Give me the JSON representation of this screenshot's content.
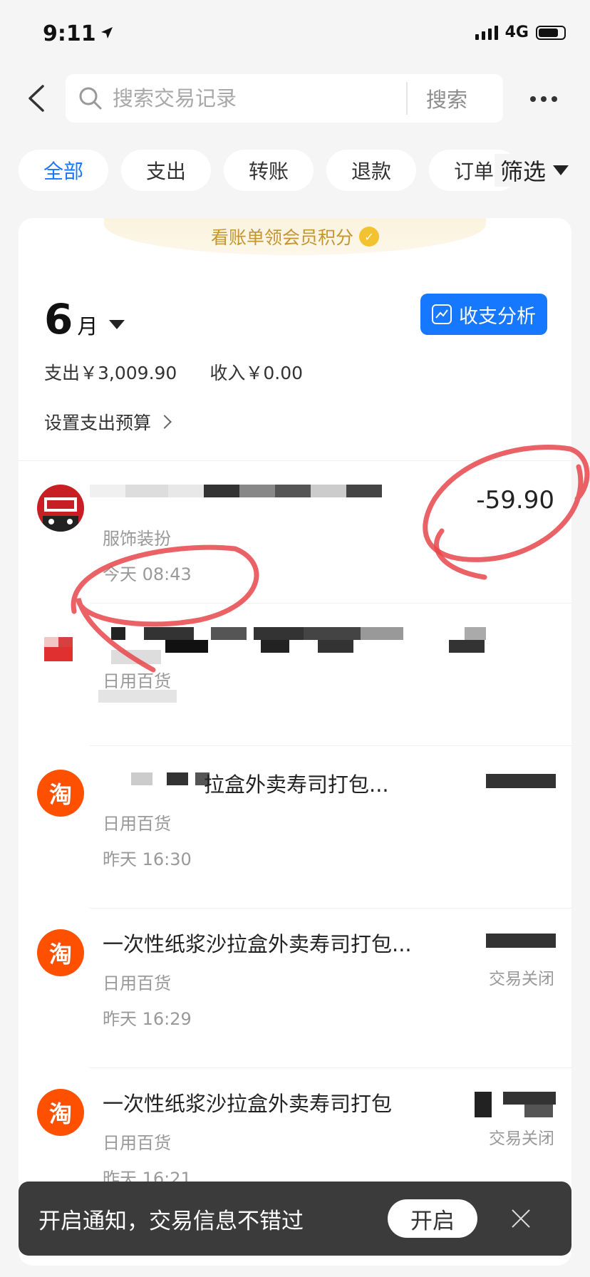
{
  "status_bar": {
    "time": "9:11",
    "network": "4G"
  },
  "search": {
    "placeholder": "搜索交易记录",
    "button_label": "搜索"
  },
  "tabs": [
    "全部",
    "支出",
    "转账",
    "退款",
    "订单"
  ],
  "filter_label": "筛选",
  "promo": {
    "text": "看账单领会员积分"
  },
  "month": {
    "number": "6",
    "unit": "月"
  },
  "analysis_button": "收支分析",
  "summary": {
    "expense": "支出￥3,009.90",
    "income": "收入￥0.00"
  },
  "budget_link": "设置支出预算",
  "transactions": [
    {
      "title": "",
      "category": "服饰装扮",
      "time": "今天 08:43",
      "amount": "-59.90",
      "status": ""
    },
    {
      "title": "",
      "category": "日用百货",
      "time": "",
      "amount": "",
      "status": ""
    },
    {
      "title": "拉盒外卖寿司打包...",
      "category": "日用百货",
      "time": "昨天 16:30",
      "amount": "",
      "status": ""
    },
    {
      "title": "一次性纸浆沙拉盒外卖寿司打包...",
      "category": "日用百货",
      "time": "昨天 16:29",
      "amount": "",
      "status": "交易关闭"
    },
    {
      "title": "一次性纸浆沙拉盒外卖寿司打包",
      "category": "日用百货",
      "time": "昨天 16:21",
      "amount": "",
      "status": "交易关闭"
    }
  ],
  "taobao_icon_text": "淘",
  "toast": {
    "text": "开启通知，交易信息不错过",
    "button": "开启"
  },
  "colors": {
    "accent": "#1677ff",
    "annotation": "#e8474b",
    "taobao": "#ff5000"
  }
}
